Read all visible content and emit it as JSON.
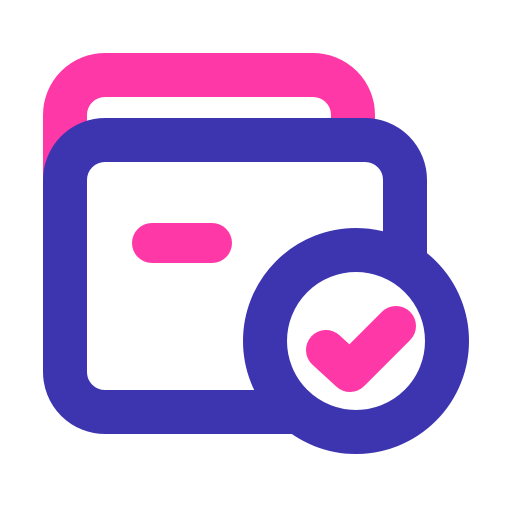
{
  "icon": {
    "name": "verified-folder-icon",
    "colors": {
      "primary": "#3d35b0",
      "accent": "#ff38a8",
      "background": "#ffffff"
    }
  }
}
